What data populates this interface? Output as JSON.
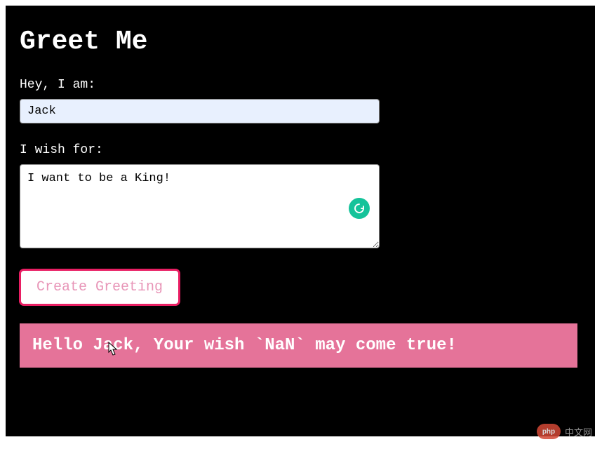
{
  "header": {
    "title": "Greet Me"
  },
  "form": {
    "name_label": "Hey, I am:",
    "name_value": "Jack",
    "wish_label": "I wish for:",
    "wish_value": "I want to be a King!",
    "submit_label": "Create Greeting"
  },
  "result": {
    "message": "Hello Jack, Your wish `NaN` may come true!"
  },
  "watermark": {
    "badge": "php",
    "text": "中文网"
  },
  "colors": {
    "background": "#000000",
    "text": "#ffffff",
    "input_autofill": "#e8f0fe",
    "button_border": "#e91e63",
    "button_text": "#e896b8",
    "banner_bg": "#e57399",
    "grammarly": "#15c39a"
  }
}
